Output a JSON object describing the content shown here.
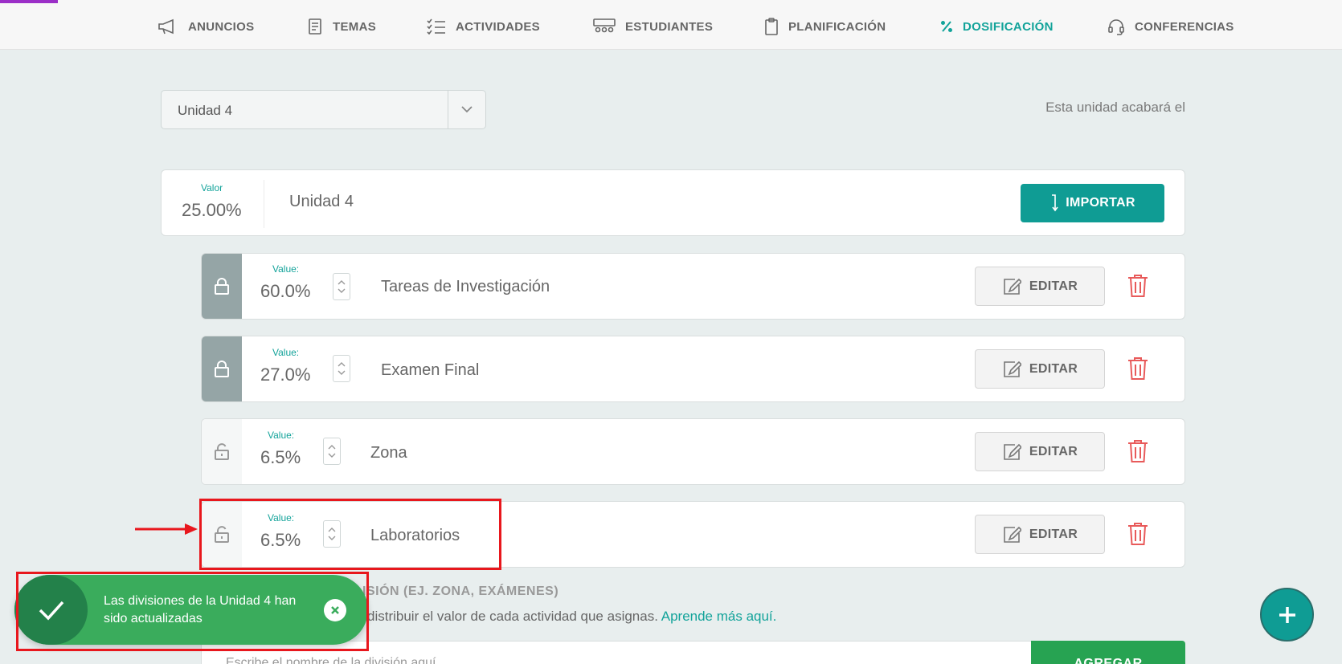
{
  "nav": {
    "items": [
      {
        "label": "ANUNCIOS",
        "icon": "megaphone-icon"
      },
      {
        "label": "TEMAS",
        "icon": "book-icon"
      },
      {
        "label": "ACTIVIDADES",
        "icon": "checklist-icon"
      },
      {
        "label": "ESTUDIANTES",
        "icon": "students-icon"
      },
      {
        "label": "PLANIFICACIÓN",
        "icon": "clipboard-icon"
      },
      {
        "label": "DOSIFICACIÓN",
        "icon": "percent-icon",
        "active": true
      },
      {
        "label": "CONFERENCIAS",
        "icon": "headset-icon"
      }
    ]
  },
  "unit_select": {
    "value": "Unidad 4"
  },
  "unit_end_text": "Esta unidad acabará el",
  "unit": {
    "valor_label": "Valor",
    "valor": "25.00%",
    "name": "Unidad 4",
    "import_label": "IMPORTAR"
  },
  "divisions": [
    {
      "label": "Value:",
      "value": "60.0%",
      "name": "Tareas de Investigación",
      "locked": true
    },
    {
      "label": "Value:",
      "value": "27.0%",
      "name": "Examen Final",
      "locked": true
    },
    {
      "label": "Value:",
      "value": "6.5%",
      "name": "Zona",
      "locked": false
    },
    {
      "label": "Value:",
      "value": "6.5%",
      "name": "Laboratorios",
      "locked": false
    }
  ],
  "edit_label": "EDITAR",
  "new_division": {
    "title": "ISIÓN (EJ. ZONA, EXÁMENES)",
    "help": "distribuir el valor de cada actividad que asignas.",
    "help_link": "Aprende más aquí.",
    "placeholder": "Escribe el nombre de la división aquí",
    "add_label": "AGREGAR"
  },
  "toast": {
    "message": "Las divisiones de la Unidad 4 han sido actualizadas"
  },
  "colors": {
    "accent": "#13a39a",
    "success": "#3aac5c",
    "danger": "#e85a5a",
    "highlight": "#e8171d"
  }
}
